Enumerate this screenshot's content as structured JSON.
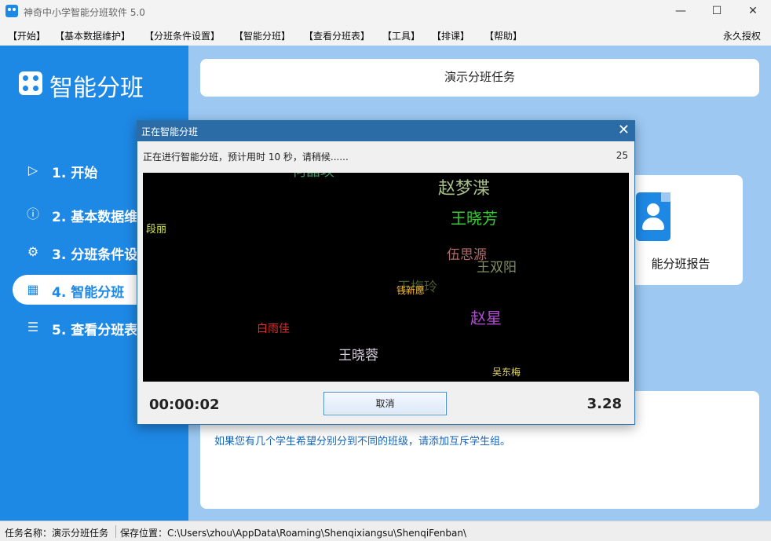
{
  "window": {
    "title": "神奇中小学智能分班软件 5.0",
    "controls": [
      "—",
      "☐",
      "✕"
    ]
  },
  "menubar": {
    "items": [
      "【开始】",
      "【基本数据维护】",
      "【分班条件设置】",
      "【智能分班】",
      "【查看分班表】",
      "【工具】",
      "【排课】",
      "【帮助】"
    ],
    "license": "永久授权"
  },
  "sidebar": {
    "brand": "智能分班",
    "items": [
      {
        "label": "1. 开始",
        "icon": "play-circle-icon"
      },
      {
        "label": "2. 基本数据维",
        "icon": "info-circle-icon"
      },
      {
        "label": "3. 分班条件设",
        "icon": "gear-icon"
      },
      {
        "label": "4. 智能分班",
        "icon": "table-icon",
        "active": true
      },
      {
        "label": "5. 查看分班表",
        "icon": "search-list-icon"
      }
    ]
  },
  "main": {
    "task_title": "演示分班任务",
    "report_label": "能分班报告",
    "hint": "如果您有几个学生希望分别分到不同的班级，请添加互斥学生组。"
  },
  "dialog": {
    "title": "正在智能分班",
    "message": "正在进行智能分班，预计用时 10 秒，请稍候......",
    "counter": "25",
    "timer": "00:00:02",
    "cancel_label": "取消",
    "ratio": "3.28",
    "names": [
      {
        "text": "何晶瑛",
        "color": "#3f8f63"
      },
      {
        "text": "赵梦渫",
        "color": "#a9c08a"
      },
      {
        "text": "王晓芳",
        "color": "#33cc33"
      },
      {
        "text": "段丽",
        "color": "#d8e85a"
      },
      {
        "text": "伍思源",
        "color": "#b06868"
      },
      {
        "text": "王双阳",
        "color": "#7f8f5f"
      },
      {
        "text": "王梅玲",
        "color": "#4b5a2f"
      },
      {
        "text": "钱新愿",
        "color": "#f0b030"
      },
      {
        "text": "赵星",
        "color": "#b04ad0"
      },
      {
        "text": "白雨佳",
        "color": "#e02b2b"
      },
      {
        "text": "王晓蓉",
        "color": "#d8d0e0"
      },
      {
        "text": "吴东梅",
        "color": "#e8d85a"
      }
    ]
  },
  "statusbar": {
    "task": "任务名称：演示分班任务",
    "path": "保存位置：C:\\Users\\zhou\\AppData\\Roaming\\Shenqixiangsu\\ShenqiFenban\\"
  }
}
